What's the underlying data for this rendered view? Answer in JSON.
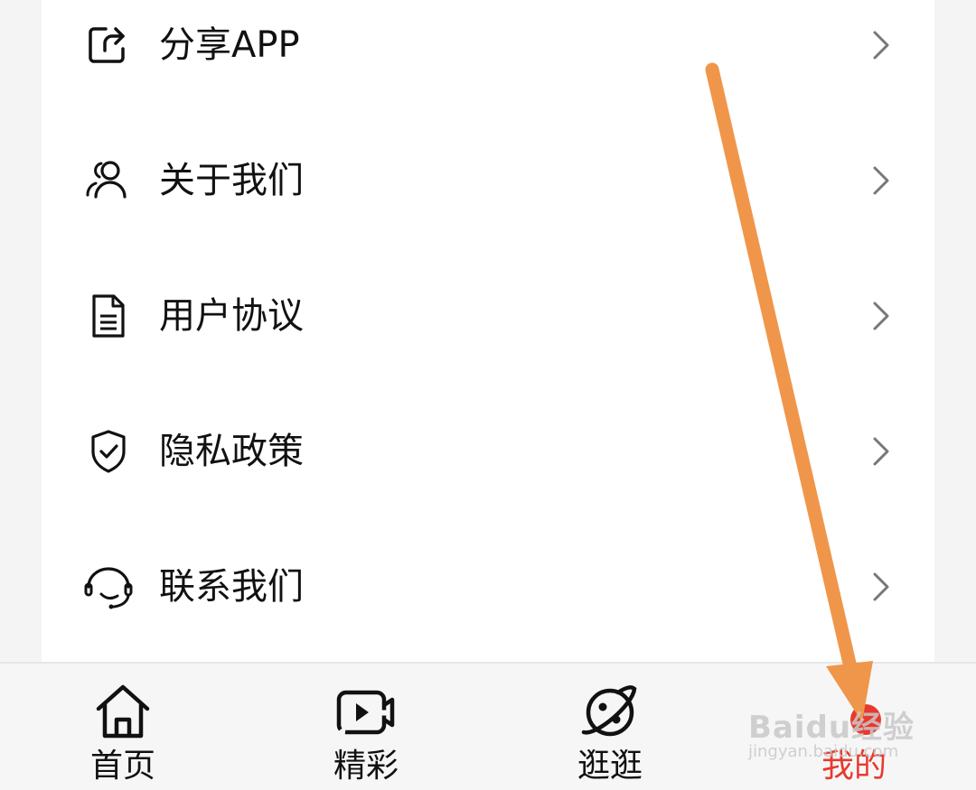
{
  "menu": {
    "items": [
      {
        "label": "分享APP",
        "icon": "share-icon"
      },
      {
        "label": "关于我们",
        "icon": "users-icon"
      },
      {
        "label": "用户协议",
        "icon": "document-icon"
      },
      {
        "label": "隐私政策",
        "icon": "shield-check-icon"
      },
      {
        "label": "联系我们",
        "icon": "headset-icon"
      }
    ]
  },
  "tabbar": {
    "tabs": [
      {
        "label": "首页",
        "icon": "home-icon"
      },
      {
        "label": "精彩",
        "icon": "video-play-icon"
      },
      {
        "label": "逛逛",
        "icon": "planet-icon"
      },
      {
        "label": "我的",
        "icon": "profile-icon",
        "active": true
      }
    ]
  },
  "colors": {
    "active_tab": "#e8392f",
    "annotation_arrow": "#f0964a",
    "chevron": "#777777"
  },
  "watermark": {
    "text": "Baidu经验",
    "subtext": "jingyan.baidu.com"
  }
}
